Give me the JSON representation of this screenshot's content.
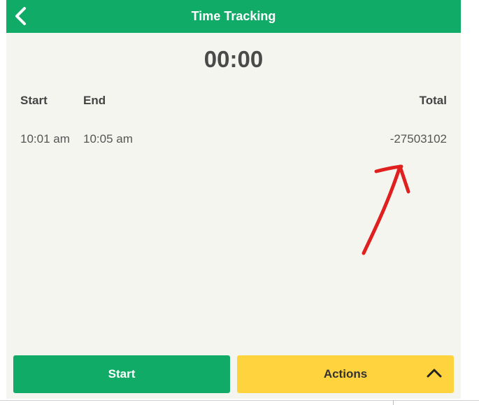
{
  "header": {
    "title": "Time Tracking",
    "back_icon": "chevron-left-icon"
  },
  "timer": {
    "value": "00:00"
  },
  "table": {
    "columns": [
      "Start",
      "End",
      "Total"
    ],
    "rows": [
      {
        "start": "10:01 am",
        "end": "10:05 am",
        "total": "-27503102"
      }
    ]
  },
  "buttons": {
    "start_label": "Start",
    "actions_label": "Actions",
    "actions_icon": "chevron-up-icon"
  },
  "colors": {
    "primary_green": "#10ac67",
    "actions_yellow": "#ffd33d",
    "background": "#f5f5f0",
    "annotation_red": "#e01f1f"
  }
}
